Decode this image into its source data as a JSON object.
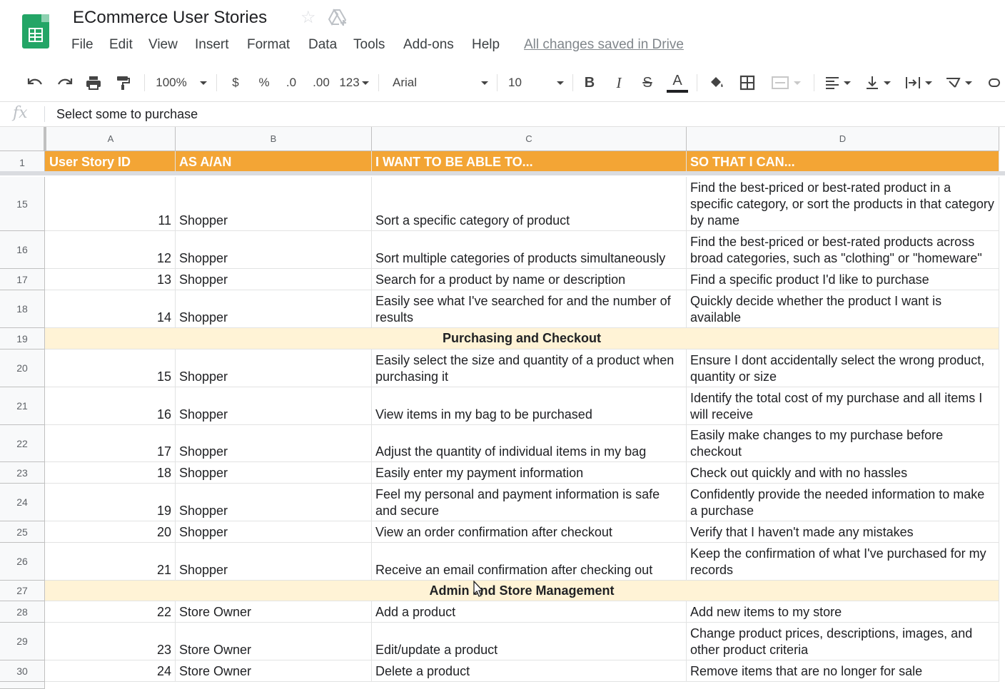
{
  "app": {
    "doc_title": "ECommerce User Stories",
    "save_status": "All changes saved in Drive",
    "menu": [
      "File",
      "Edit",
      "View",
      "Insert",
      "Format",
      "Data",
      "Tools",
      "Add-ons",
      "Help"
    ]
  },
  "toolbar": {
    "zoom": "100%",
    "currency": "$",
    "percent": "%",
    "decrease_decimal": ".0",
    "increase_decimal": ".00",
    "more_formats": "123",
    "font": "Arial",
    "font_size": "10",
    "bold": "B",
    "italic": "I",
    "strike": "S",
    "text_color": "A",
    "text_color_value": "#202124"
  },
  "formula_bar": {
    "fx": "fx",
    "content": "Select some to purchase"
  },
  "columns": [
    "A",
    "B",
    "C",
    "D"
  ],
  "header_row": {
    "row_number": "1",
    "cells": [
      "User Story ID",
      "AS A/AN",
      "I WANT TO BE ABLE TO...",
      "SO THAT I CAN..."
    ]
  },
  "rows": [
    {
      "row_number": "15",
      "id": "11",
      "role": "Shopper",
      "want": "Sort a specific category of product",
      "so_that": "Find the best-priced or best-rated product in a specific category, or sort the products in that category by name"
    },
    {
      "row_number": "16",
      "id": "12",
      "role": "Shopper",
      "want": "Sort multiple categories of products simultaneously",
      "so_that": "Find the best-priced or best-rated products across broad categories, such as \"clothing\" or \"homeware\""
    },
    {
      "row_number": "17",
      "id": "13",
      "role": "Shopper",
      "want": "Search for a product by name or description",
      "so_that": "Find a specific product I'd like to purchase"
    },
    {
      "row_number": "18",
      "id": "14",
      "role": "Shopper",
      "want": "Easily see what I've searched for and the number of results",
      "so_that": "Quickly decide whether the product I want is available"
    },
    {
      "row_number": "19",
      "section": "Purchasing and Checkout"
    },
    {
      "row_number": "20",
      "id": "15",
      "role": "Shopper",
      "want": "Easily select the size and quantity of a product when purchasing it",
      "so_that": "Ensure I dont accidentally select the wrong product, quantity or size"
    },
    {
      "row_number": "21",
      "id": "16",
      "role": "Shopper",
      "want": "View items in my bag to be purchased",
      "so_that": "Identify the total cost of my purchase and all items I will receive"
    },
    {
      "row_number": "22",
      "id": "17",
      "role": "Shopper",
      "want": "Adjust the quantity of individual items in my bag",
      "so_that": "Easily make changes to my purchase before checkout"
    },
    {
      "row_number": "23",
      "id": "18",
      "role": "Shopper",
      "want": "Easily enter my payment information",
      "so_that": "Check out quickly and with no hassles"
    },
    {
      "row_number": "24",
      "id": "19",
      "role": "Shopper",
      "want": "Feel my personal and payment information is safe and secure",
      "so_that": "Confidently provide the needed information to make a purchase"
    },
    {
      "row_number": "25",
      "id": "20",
      "role": "Shopper",
      "want": "View an order confirmation after checkout",
      "so_that": "Verify that I haven't made any mistakes"
    },
    {
      "row_number": "26",
      "id": "21",
      "role": "Shopper",
      "want": "Receive an email confirmation after checking out",
      "so_that": "Keep the confirmation of what I've purchased for my records"
    },
    {
      "row_number": "27",
      "section": "Admin and Store Management"
    },
    {
      "row_number": "28",
      "id": "22",
      "role": "Store Owner",
      "want": "Add a product",
      "so_that": "Add new items to my store"
    },
    {
      "row_number": "29",
      "id": "23",
      "role": "Store Owner",
      "want": "Edit/update a product",
      "so_that": "Change product prices, descriptions, images, and other product criteria"
    },
    {
      "row_number": "30",
      "id": "24",
      "role": "Store Owner",
      "want": "Delete a product",
      "so_that": "Remove items that are no longer for sale"
    }
  ],
  "colors": {
    "header_bg": "#f3a535",
    "section_bg": "#fff3d6",
    "sheets_green": "#23a566"
  }
}
